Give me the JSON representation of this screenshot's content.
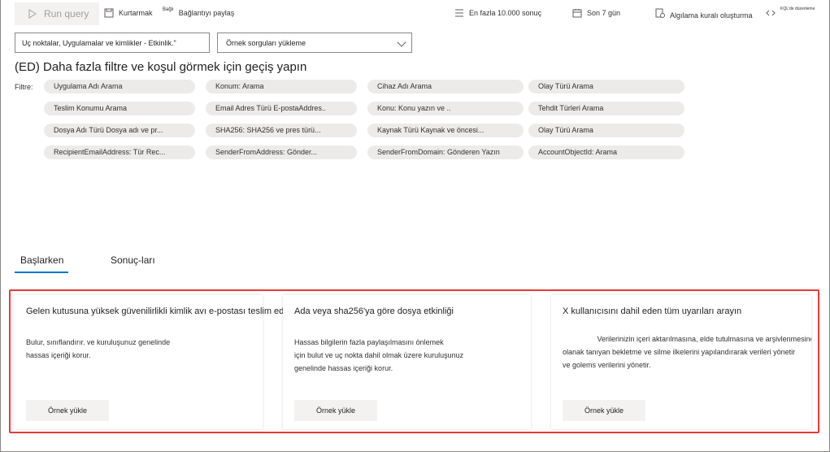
{
  "toolbar": {
    "run_query": "Run query",
    "save": "Kurtarmak",
    "share_sup": "Bağlı",
    "share_link": "Bağlantıyı paylaş",
    "max_results": "En fazla 10.000 sonuç",
    "time_range": "Son 7 gün",
    "create_rule": "Algılama kuralı oluşturma",
    "edit_kql": "KQL'de düzenleme"
  },
  "search": {
    "value": "Uç noktalar, Uygulamalar ve kimlikler - Etkinlik.\""
  },
  "sample_select": {
    "value": "Örnek sorguları yükleme"
  },
  "heading": "(ED) Daha fazla filtre ve koşul görmek için geçiş yapın",
  "filter_label": "Filtre:",
  "filters": [
    [
      "Uygulama Adı Arama",
      "Konum: Arama",
      "Cihaz Adı Arama",
      "Olay Türü Arama"
    ],
    [
      "Teslim Konumu Arama",
      "Email Adres Türü E-postaAddres..",
      "Konu: Konu yazın ve ..",
      "Tehdit Türleri Arama"
    ],
    [
      "Dosya Adı Türü Dosya adı ve pr...",
      "SHA256: SHA256 ve pres türü...",
      "Kaynak Türü Kaynak ve öncesi...",
      "Olay Türü Arama"
    ],
    [
      "RecipientEmailAddress: Tür Rec...",
      "SenderFromAddress: Gönder...",
      "SenderFromDomain: Gönderen Yazın",
      "AccountObjectId: Arama"
    ]
  ],
  "tabs": [
    "Başlarken",
    "Sonuç-ları"
  ],
  "cards": [
    {
      "title": "Gelen kutusuna yüksek güvenilirlikli kimlik avı e-postası teslim edildi",
      "desc": "Bulur, sınıflandırır. ve kuruluşunuz genelinde\nhassas içeriği korur.",
      "button": "Örnek yükle"
    },
    {
      "title": "Ada veya sha256'ya göre dosya etkinliği",
      "desc": "Hassas bilgilerin fazla paylaşılmasını önlemek\niçin bulut ve uç nokta dahil olmak üzere kuruluşunuz\ngenelinde hassas içeriği korur.",
      "button": "Örnek yükle"
    },
    {
      "title": "X kullanıcısını dahil eden tüm uyarıları arayın",
      "desc": "                 Verilerinizin içeri aktarılmasına, elde tutulmasına ve arşivlenmesine\nolanak tanıyan bekletme ve silme ilkelerini yapılandırarak verileri yönetir\nve golems verilerini yönetir.",
      "button": "Örnek yükle"
    }
  ]
}
